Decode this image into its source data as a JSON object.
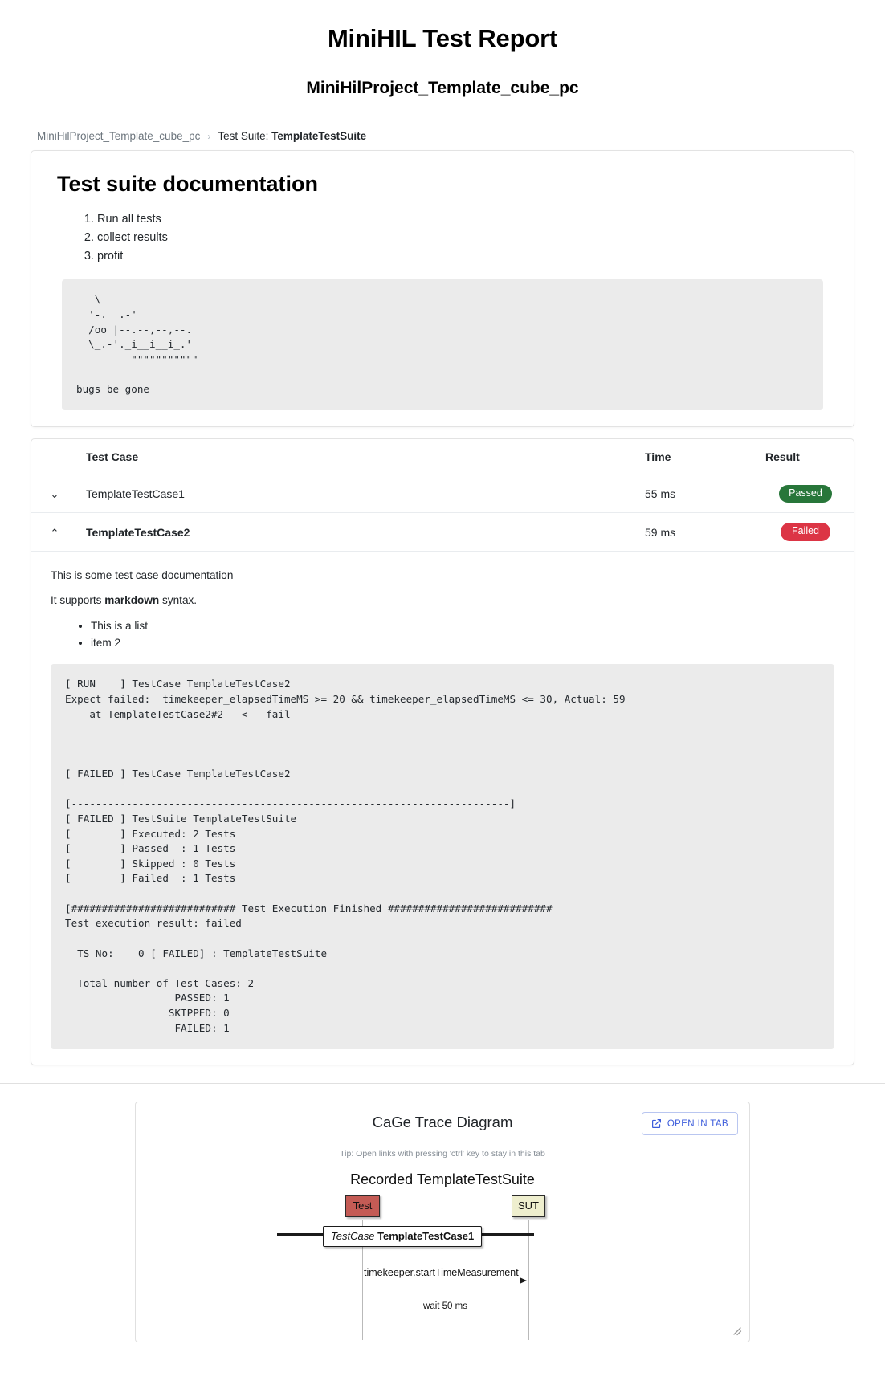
{
  "header": {
    "title": "MiniHIL Test Report",
    "subtitle": "MiniHilProject_Template_cube_pc"
  },
  "breadcrumb": {
    "root": "MiniHilProject_Template_cube_pc",
    "separator": "›",
    "current_prefix": "Test Suite: ",
    "current_value": "TemplateTestSuite"
  },
  "suite_doc": {
    "heading": "Test suite documentation",
    "steps": [
      "Run all tests",
      "collect results",
      "profit"
    ],
    "ascii_art": "   \\\n  '-.__.-'\n  /oo |--.--,--,--.\n  \\_.-'._i__i__i_.'\n         \"\"\"\"\"\"\"\"\"\"\"\n\nbugs be gone"
  },
  "table": {
    "headers": {
      "test_case": "Test Case",
      "time": "Time",
      "result": "Result"
    },
    "rows": [
      {
        "name": "TemplateTestCase1",
        "time": "55 ms",
        "result": "Passed",
        "result_kind": "pass",
        "chevron": "⌄",
        "expanded": false
      },
      {
        "name": "TemplateTestCase2",
        "time": "59 ms",
        "result": "Failed",
        "result_kind": "fail",
        "chevron": "⌃",
        "expanded": true
      }
    ]
  },
  "detail": {
    "paragraph_1": "This is some test case documentation",
    "paragraph_2_pre": "It supports ",
    "paragraph_2_bold": "markdown",
    "paragraph_2_post": " syntax.",
    "list": [
      "This is a list",
      "item 2"
    ],
    "log": "[ RUN    ] TestCase TemplateTestCase2\nExpect failed:  timekeeper_elapsedTimeMS >= 20 && timekeeper_elapsedTimeMS <= 30, Actual: 59\n    at TemplateTestCase2#2   <-- fail\n\n\n\n[ FAILED ] TestCase TemplateTestCase2\n\n[------------------------------------------------------------------------]\n[ FAILED ] TestSuite TemplateTestSuite\n[        ] Executed: 2 Tests\n[        ] Passed  : 1 Tests\n[        ] Skipped : 0 Tests\n[        ] Failed  : 1 Tests\n\n[########################### Test Execution Finished ###########################\nTest execution result: failed\n\n  TS No:    0 [ FAILED] : TemplateTestSuite\n\n  Total number of Test Cases: 2\n                  PASSED: 1\n                 SKIPPED: 0\n                  FAILED: 1"
  },
  "trace": {
    "title": "CaGe Trace Diagram",
    "open_in_tab_label": "OPEN IN TAB",
    "tip": "Tip: Open links with pressing 'ctrl' key to stay in this tab",
    "diagram_title": "Recorded TemplateTestSuite",
    "actor_left": "Test",
    "actor_right": "SUT",
    "message_label_italic": "TestCase",
    "message_label_bold": "TemplateTestCase1",
    "call_label": "timekeeper.startTimeMeasurement",
    "wait_label": "wait 50 ms"
  },
  "colors": {
    "pass_badge": "#28763a",
    "fail_badge": "#dc3545",
    "accent_link": "#3b5bdb",
    "code_bg": "#ebebeb",
    "actor_left_bg": "#c45b55",
    "actor_right_bg": "#eeeece"
  }
}
